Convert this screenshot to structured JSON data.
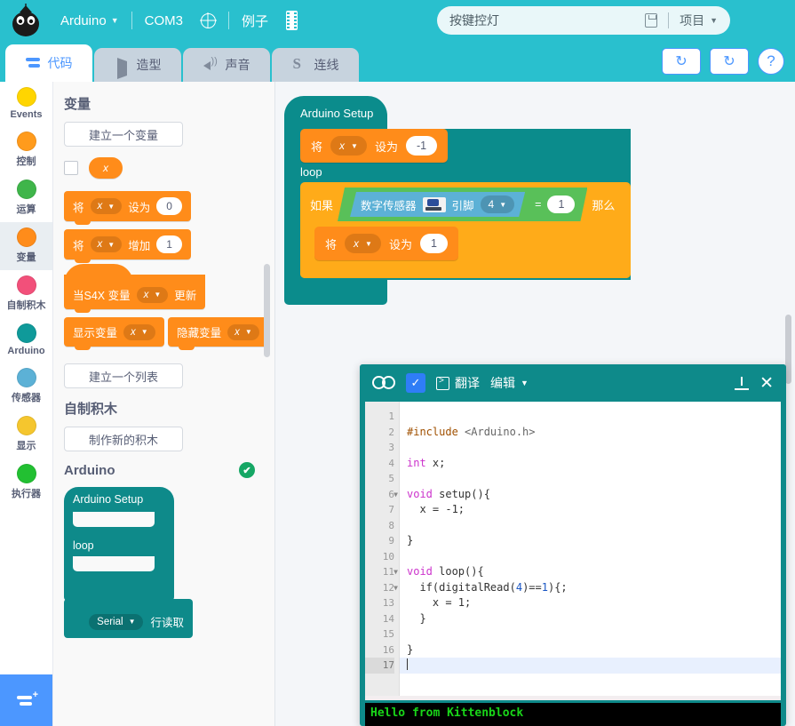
{
  "topbar": {
    "logo_name": "kittenblock-cat-logo",
    "board_menu": "Arduino",
    "port": "COM3",
    "globe_icon": "globe-icon",
    "examples": "例子",
    "chip_icon": "chip-icon",
    "project_name": "按键控灯",
    "save_icon": "save-icon",
    "project_menu": "项目"
  },
  "tabs": [
    {
      "label": "代码",
      "icon": "code-icon",
      "active": true
    },
    {
      "label": "造型",
      "icon": "brush-icon",
      "active": false
    },
    {
      "label": "声音",
      "icon": "speaker-icon",
      "active": false
    },
    {
      "label": "连线",
      "icon": "wire-icon",
      "active": false
    }
  ],
  "tab_buttons": [
    {
      "name": "refresh-button-1",
      "glyph": "↻"
    },
    {
      "name": "refresh-button-2",
      "glyph": "↻"
    },
    {
      "name": "help-button",
      "glyph": "?"
    }
  ],
  "categories": [
    {
      "label": "Events",
      "color": "#ffd500",
      "selected": false
    },
    {
      "label": "控制",
      "color": "#ff9b1c",
      "selected": false
    },
    {
      "label": "运算",
      "color": "#3fb54a",
      "selected": false
    },
    {
      "label": "变量",
      "color": "#ff8c1a",
      "selected": true
    },
    {
      "label": "自制积木",
      "color": "#f2507a",
      "selected": false
    },
    {
      "label": "Arduino",
      "color": "#0f9a9a",
      "selected": false
    },
    {
      "label": "传感器",
      "color": "#5cb1d6",
      "selected": false
    },
    {
      "label": "显示",
      "color": "#f5c62e",
      "selected": false
    },
    {
      "label": "执行器",
      "color": "#22c032",
      "selected": false
    }
  ],
  "add_extension_label": "add-extension-button",
  "palette": {
    "variables_header": "变量",
    "make_variable_button": "建立一个变量",
    "variable_x": "x",
    "set_block": {
      "prefix": "将",
      "var": "x",
      "mid": "设为",
      "value": "0"
    },
    "change_block": {
      "prefix": "将",
      "var": "x",
      "mid": "增加",
      "value": "1"
    },
    "s4x_block": {
      "prefix": "当S4X 变量",
      "var": "x",
      "suffix": "更新"
    },
    "show_block": {
      "label": "显示变量",
      "var": "x"
    },
    "hide_block": {
      "label": "隐藏变量",
      "var": "x"
    },
    "make_list_button": "建立一个列表",
    "myblocks_header": "自制积木",
    "make_block_button": "制作新的积木",
    "arduino_header": "Arduino",
    "arduino_checked": "✔",
    "arduino_setup_label": "Arduino Setup",
    "arduino_loop_label": "loop",
    "serial_block": {
      "port": "Serial",
      "label": "行读取"
    }
  },
  "workspace": {
    "setup_label": "Arduino Setup",
    "loop_label": "loop",
    "setup_stmt": {
      "prefix": "将",
      "var": "x",
      "mid": "设为",
      "value": "-1"
    },
    "if_prefix": "如果",
    "if_suffix": "那么",
    "sensor_label": "数字传感器",
    "sensor_icon": "digital-sensor-image",
    "pin_label": "引脚",
    "pin_value": "4",
    "operator": "=",
    "compare_value": "1",
    "loop_stmt": {
      "prefix": "将",
      "var": "x",
      "mid": "设为",
      "value": "1"
    }
  },
  "codepanel": {
    "arduino_icon": "arduino-infinity-logo",
    "verify_icon": "check-icon",
    "terminal_icon": "terminal-icon",
    "translate_label": "翻译",
    "edit_label": "编辑",
    "upload_icon": "upload-icon",
    "close_icon": "close-icon",
    "line_count": 17,
    "current_line": 17,
    "fold_lines": [
      6,
      11,
      12
    ],
    "lines": [
      "",
      "#include <Arduino.h>",
      "",
      "int x;",
      "",
      "void setup(){",
      "  x = -1;",
      "",
      "}",
      "",
      "void loop(){",
      "  if(digitalRead(4)==1){;",
      "    x = 1;",
      "  }",
      "",
      "}",
      ""
    ],
    "console_text": "Hello from Kittenblock"
  }
}
